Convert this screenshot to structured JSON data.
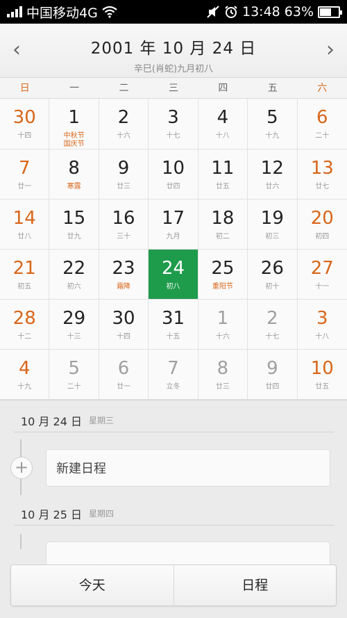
{
  "status": {
    "carrier": "中国移动4G",
    "time": "13:48",
    "battery": "63%",
    "battery_level": 0.63,
    "icons": [
      "signal-icon",
      "wifi-icon",
      "mute-icon",
      "alarm-icon",
      "battery-icon"
    ]
  },
  "header": {
    "title": "2001 年 10 月 24 日",
    "subtitle": "辛巳(肖蛇)九月初八",
    "prev_icon": "chevron-left-icon",
    "next_icon": "chevron-right-icon"
  },
  "weekdays": [
    "日",
    "一",
    "二",
    "三",
    "四",
    "五",
    "六"
  ],
  "calendar": [
    {
      "day": "30",
      "lunar": "十四",
      "other": true
    },
    {
      "day": "1",
      "lunar": "中秋节\n国庆节",
      "fest": true
    },
    {
      "day": "2",
      "lunar": "十六"
    },
    {
      "day": "3",
      "lunar": "十七"
    },
    {
      "day": "4",
      "lunar": "十八"
    },
    {
      "day": "5",
      "lunar": "十九"
    },
    {
      "day": "6",
      "lunar": "二十"
    },
    {
      "day": "7",
      "lunar": "廿一"
    },
    {
      "day": "8",
      "lunar": "寒露",
      "fest": true
    },
    {
      "day": "9",
      "lunar": "廿三"
    },
    {
      "day": "10",
      "lunar": "廿四"
    },
    {
      "day": "11",
      "lunar": "廿五"
    },
    {
      "day": "12",
      "lunar": "廿六"
    },
    {
      "day": "13",
      "lunar": "廿七"
    },
    {
      "day": "14",
      "lunar": "廿八"
    },
    {
      "day": "15",
      "lunar": "廿九"
    },
    {
      "day": "16",
      "lunar": "三十"
    },
    {
      "day": "17",
      "lunar": "九月"
    },
    {
      "day": "18",
      "lunar": "初二"
    },
    {
      "day": "19",
      "lunar": "初三"
    },
    {
      "day": "20",
      "lunar": "初四"
    },
    {
      "day": "21",
      "lunar": "初五"
    },
    {
      "day": "22",
      "lunar": "初六"
    },
    {
      "day": "23",
      "lunar": "霜降",
      "fest": true
    },
    {
      "day": "24",
      "lunar": "初八",
      "selected": true
    },
    {
      "day": "25",
      "lunar": "重阳节",
      "fest": true
    },
    {
      "day": "26",
      "lunar": "初十"
    },
    {
      "day": "27",
      "lunar": "十一"
    },
    {
      "day": "28",
      "lunar": "十二"
    },
    {
      "day": "29",
      "lunar": "十三"
    },
    {
      "day": "30",
      "lunar": "十四"
    },
    {
      "day": "31",
      "lunar": "十五"
    },
    {
      "day": "1",
      "lunar": "十六",
      "other": true
    },
    {
      "day": "2",
      "lunar": "十七",
      "other": true
    },
    {
      "day": "3",
      "lunar": "十八",
      "other": true
    },
    {
      "day": "4",
      "lunar": "十九",
      "other": true
    },
    {
      "day": "5",
      "lunar": "二十",
      "other": true
    },
    {
      "day": "6",
      "lunar": "廿一",
      "other": true
    },
    {
      "day": "7",
      "lunar": "立冬",
      "other": true
    },
    {
      "day": "8",
      "lunar": "廿三",
      "other": true
    },
    {
      "day": "9",
      "lunar": "廿四",
      "other": true
    },
    {
      "day": "10",
      "lunar": "廿五",
      "other": true
    }
  ],
  "schedule": {
    "day1_date": "10 月 24 日",
    "day1_week": "星期三",
    "new_event": "新建日程",
    "day2_date": "10 月 25 日",
    "day2_week": "星期四"
  },
  "bottom": {
    "today": "今天",
    "events": "日程"
  },
  "colors": {
    "selected": "#1f9b4c",
    "weekend": "#d8661a",
    "festival": "#d8661a"
  }
}
